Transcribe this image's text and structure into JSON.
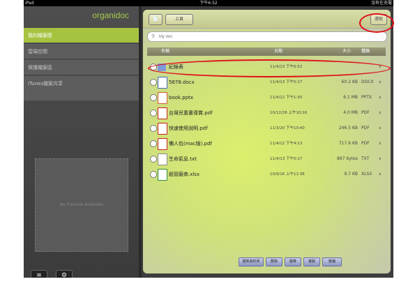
{
  "statusbar": {
    "device": "iPad",
    "time": "下午6:52",
    "battery": "沒有在充電"
  },
  "sidebar": {
    "logo": "organidoc",
    "items": [
      {
        "label": "我的檔案匣"
      },
      {
        "label": "雲端空間"
      },
      {
        "label": "保護檔案區"
      },
      {
        "label": "iTunes檔案共享"
      }
    ],
    "preview_text": "No Preview Available",
    "wifi_icon": "wifi-icon",
    "settings_icon": "gear-icon"
  },
  "toolbar": {
    "left_icon": "document-icon",
    "breadcrumb": "上頁",
    "select_label": "選取"
  },
  "search": {
    "placeholder": "My doc"
  },
  "table": {
    "headers": {
      "name": "名稱",
      "date": "日期",
      "size": "大小",
      "type": "種類"
    },
    "rows": [
      {
        "name": "紀錄表",
        "date": "11/4/13 下午6:52",
        "size": "",
        "ext": "",
        "icon": "folder-icon"
      },
      {
        "name": "5678.docx",
        "date": "11/4/13 下午5:17",
        "size": "60.2 KB",
        "ext": "DOCX",
        "icon": "word-icon"
      },
      {
        "name": "book.pptx",
        "date": "11/4/12 下午1:30",
        "size": "6.1 MB",
        "ext": "PPTX",
        "icon": "powerpoint-icon"
      },
      {
        "name": "台灣兒童書導賞.pdf",
        "date": "10/12/28 上午10:16",
        "size": "4.0 MB",
        "ext": "PDF",
        "icon": "pdf-icon"
      },
      {
        "name": "快速使用說明.pdf",
        "date": "11/3/20 下午10:40",
        "size": "246.5 KB",
        "ext": "PDF",
        "icon": "pdf-icon"
      },
      {
        "name": "懶人包(mac版).pdf",
        "date": "11/4/12 下午4:13",
        "size": "717.6 KB",
        "ext": "PDF",
        "icon": "pdf-icon"
      },
      {
        "name": "生命氣息.txt",
        "date": "11/4/13 下午5:17",
        "size": "897 bytes",
        "ext": "TXT",
        "icon": "text-file-icon"
      },
      {
        "name": "紙管廠商.xlsx",
        "date": "10/9/16 上午11:36",
        "size": "9.7 KB",
        "ext": "XLSX",
        "icon": "excel-icon"
      }
    ]
  },
  "bottom_buttons": [
    {
      "label": "建新資料夾"
    },
    {
      "label": "刪除"
    },
    {
      "label": "搬移"
    },
    {
      "label": "複製"
    },
    {
      "label": "壓縮"
    }
  ],
  "colors": {
    "accent": "#a6c340",
    "highlight": "#e0101a"
  }
}
